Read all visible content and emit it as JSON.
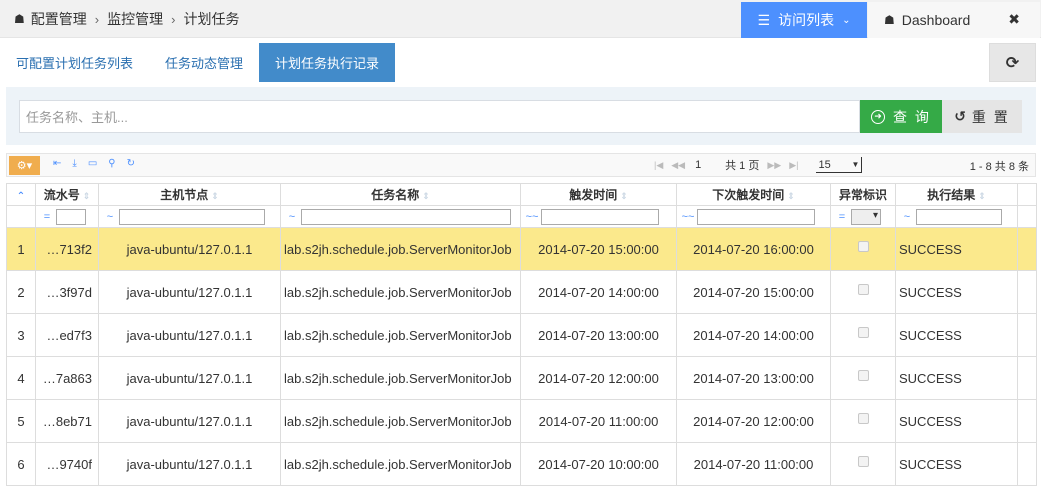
{
  "breadcrumb": {
    "items": [
      "配置管理",
      "监控管理",
      "计划任务"
    ]
  },
  "top_nav": {
    "visit_list_label": "访问列表",
    "dashboard_label": "Dashboard"
  },
  "tabs": [
    {
      "label": "可配置计划任务列表",
      "active": false
    },
    {
      "label": "任务动态管理",
      "active": false
    },
    {
      "label": "计划任务执行记录",
      "active": true
    }
  ],
  "search": {
    "placeholder": "任务名称、主机...",
    "query_label": "查 询",
    "reset_label": "重 置"
  },
  "pager": {
    "page": "1",
    "total_pages_text": "共 1 页",
    "page_size": "15",
    "records_text": "1 - 8   共 8 条"
  },
  "columns": [
    {
      "label": "",
      "filter_op": ""
    },
    {
      "label": "流水号",
      "filter_op": "="
    },
    {
      "label": "主机节点",
      "filter_op": "~"
    },
    {
      "label": "任务名称",
      "filter_op": "~"
    },
    {
      "label": "触发时间",
      "filter_op": "~~"
    },
    {
      "label": "下次触发时间",
      "filter_op": "~~"
    },
    {
      "label": "异常标识",
      "filter_op": "="
    },
    {
      "label": "执行结果",
      "filter_op": "~"
    }
  ],
  "rows": [
    {
      "num": "1",
      "sn": "…713f2",
      "host": "java-ubuntu/127.0.1.1",
      "job": "lab.s2jh.schedule.job.ServerMonitorJob",
      "fire": "2014-07-20 15:00:00",
      "next": "2014-07-20 16:00:00",
      "result": "SUCCESS"
    },
    {
      "num": "2",
      "sn": "…3f97d",
      "host": "java-ubuntu/127.0.1.1",
      "job": "lab.s2jh.schedule.job.ServerMonitorJob",
      "fire": "2014-07-20 14:00:00",
      "next": "2014-07-20 15:00:00",
      "result": "SUCCESS"
    },
    {
      "num": "3",
      "sn": "…ed7f3",
      "host": "java-ubuntu/127.0.1.1",
      "job": "lab.s2jh.schedule.job.ServerMonitorJob",
      "fire": "2014-07-20 13:00:00",
      "next": "2014-07-20 14:00:00",
      "result": "SUCCESS"
    },
    {
      "num": "4",
      "sn": "…7a863",
      "host": "java-ubuntu/127.0.1.1",
      "job": "lab.s2jh.schedule.job.ServerMonitorJob",
      "fire": "2014-07-20 12:00:00",
      "next": "2014-07-20 13:00:00",
      "result": "SUCCESS"
    },
    {
      "num": "5",
      "sn": "…8eb71",
      "host": "java-ubuntu/127.0.1.1",
      "job": "lab.s2jh.schedule.job.ServerMonitorJob",
      "fire": "2014-07-20 11:00:00",
      "next": "2014-07-20 12:00:00",
      "result": "SUCCESS"
    },
    {
      "num": "6",
      "sn": "…9740f",
      "host": "java-ubuntu/127.0.1.1",
      "job": "lab.s2jh.schedule.job.ServerMonitorJob",
      "fire": "2014-07-20 10:00:00",
      "next": "2014-07-20 11:00:00",
      "result": "SUCCESS"
    }
  ],
  "colors": {
    "primary": "#4d90fe",
    "tab_active": "#428bca",
    "query_green": "#35aa47",
    "selected_row": "#fbe98c",
    "gear_orange": "#f0ad4e"
  }
}
